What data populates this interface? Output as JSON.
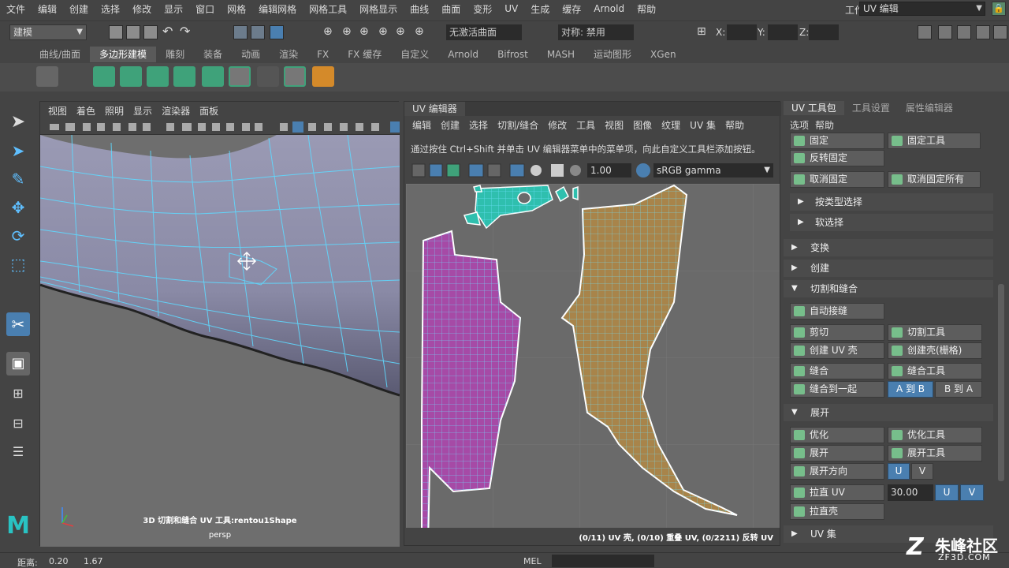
{
  "menubar": {
    "items": [
      "文件",
      "编辑",
      "创建",
      "选择",
      "修改",
      "显示",
      "窗口",
      "网格",
      "编辑网格",
      "网格工具",
      "网格显示",
      "曲线",
      "曲面",
      "变形",
      "UV",
      "生成",
      "缓存",
      "Arnold",
      "帮助"
    ],
    "workspace_label": "工作区:",
    "workspace_value": "UV 编辑"
  },
  "statusline": {
    "mode": "建模",
    "live_surface": "无激活曲面",
    "symmetry": "对称: 禁用",
    "x_label": "X:",
    "y_label": "Y:",
    "z_label": "Z:"
  },
  "shelf": {
    "tabs": [
      "曲线/曲面",
      "多边形建模",
      "雕刻",
      "装备",
      "动画",
      "渲染",
      "FX",
      "FX 缓存",
      "自定义",
      "Arnold",
      "Bifrost",
      "MASH",
      "运动图形",
      "XGen"
    ],
    "active_index": 1
  },
  "viewport": {
    "menu": [
      "视图",
      "着色",
      "照明",
      "显示",
      "渲染器",
      "面板"
    ],
    "hud_text": "3D 切割和缝合 UV 工具:rentou1Shape",
    "camera": "persp"
  },
  "uv_editor": {
    "tab": "UV 编辑器",
    "menu": [
      "编辑",
      "创建",
      "选择",
      "切割/缝合",
      "修改",
      "工具",
      "视图",
      "图像",
      "纹理",
      "UV 集",
      "帮助"
    ],
    "hint": "通过按住 Ctrl+Shift 并单击 UV 编辑器菜单中的菜单项，向此自定义工具栏添加按钮。",
    "gamma_value": "1.00",
    "color_space": "sRGB gamma",
    "status": "(0/11) UV 壳, (0/10) 重叠 UV, (0/2211) 反转 UV"
  },
  "toolkit": {
    "tabs": [
      "UV 工具包",
      "工具设置",
      "属性编辑器"
    ],
    "menu": [
      "选项",
      "帮助"
    ],
    "buttons": {
      "pin": "固定",
      "pin_tool": "固定工具",
      "invert_pin": "反转固定",
      "unpin": "取消固定",
      "unpin_all": "取消固定所有",
      "auto_seams": "自动接缝",
      "cut": "剪切",
      "cut_tool": "切割工具",
      "create_shell": "创建 UV 壳",
      "create_shell_grid": "创建壳(栅格)",
      "sew": "缝合",
      "sew_tool": "缝合工具",
      "sew_together": "缝合到一起",
      "a_to_b": "A 到 B",
      "b_to_a": "B 到 A",
      "optimize": "优化",
      "optimize_tool": "优化工具",
      "unfold": "展开",
      "unfold_tool": "展开工具",
      "unfold_along": "展开方向",
      "straighten_uv": "拉直 UV",
      "straighten_shell": "拉直壳",
      "u": "U",
      "v": "V",
      "angle": "30.00"
    },
    "sections": {
      "select_by_type": "按类型选择",
      "soft_select": "软选择",
      "transform": "变换",
      "create": "创建",
      "cut_sew": "切割和缝合",
      "unfold": "展开",
      "uv_sets": "UV 集"
    }
  },
  "bottom": {
    "distance_label": "距离:",
    "distance_value": "0.20",
    "value2": "1.67",
    "mel_label": "MEL"
  },
  "watermark": {
    "title": "朱峰社区",
    "sub": "ZF3D.COM"
  },
  "colors": {
    "wire": "#5fd9ff",
    "shell_purple": "#a64aa6",
    "shell_brown": "#a8844a",
    "shell_cyan": "#2fbfae",
    "accent_blue": "#4a7fb0"
  }
}
